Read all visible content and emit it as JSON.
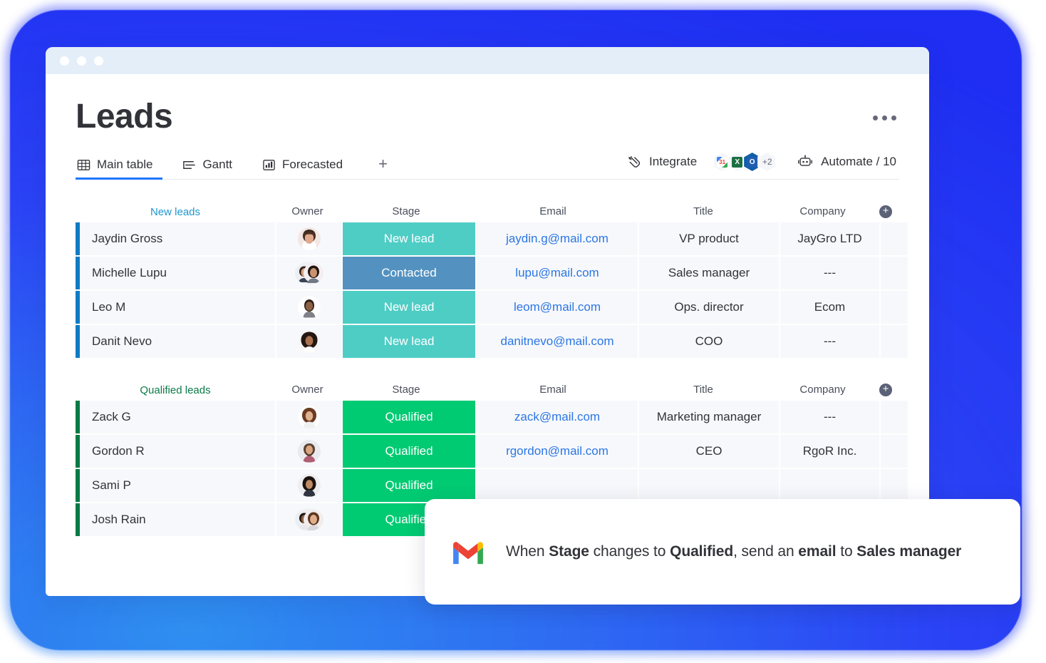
{
  "window": {
    "title_bar_dots": 3
  },
  "header": {
    "title": "Leads",
    "overflow_menu": "..."
  },
  "tabs": [
    {
      "label": "Main table",
      "icon": "table-icon",
      "active": true
    },
    {
      "label": "Gantt",
      "icon": "gantt-icon",
      "active": false
    },
    {
      "label": "Forecasted",
      "icon": "chart-bar-icon",
      "active": false
    }
  ],
  "add_tab_label": "+",
  "toolbar": {
    "integrate_label": "Integrate",
    "integration_badges": [
      {
        "name": "google-calendar",
        "label": "31"
      },
      {
        "name": "excel",
        "label": "X"
      },
      {
        "name": "outlook",
        "label": "O"
      },
      {
        "name": "more",
        "label": "+2"
      }
    ],
    "automate_label": "Automate / 10"
  },
  "columns": {
    "owner": "Owner",
    "stage": "Stage",
    "email": "Email",
    "title": "Title",
    "company": "Company",
    "add": "+"
  },
  "groups": [
    {
      "name": "New leads",
      "color": "#1f97d0",
      "rows": [
        {
          "name": "Jaydin Gross",
          "owner": "single-female",
          "stage": "New lead",
          "stage_color": "#4ecdc5",
          "email": "jaydin.g@mail.com",
          "title": "VP product",
          "company": "JayGro LTD"
        },
        {
          "name": "Michelle Lupu",
          "owner": "pair",
          "stage": "Contacted",
          "stage_color": "#5392c0",
          "email": "lupu@mail.com",
          "title": "Sales manager",
          "company": "---"
        },
        {
          "name": "Leo M",
          "owner": "single-male",
          "stage": "New lead",
          "stage_color": "#4ecdc5",
          "email": "leom@mail.com",
          "title": "Ops. director",
          "company": "Ecom"
        },
        {
          "name": "Danit Nevo",
          "owner": "single-female",
          "stage": "New lead",
          "stage_color": "#4ecdc5",
          "email": "danitnevo@mail.com",
          "title": "COO",
          "company": "---"
        }
      ]
    },
    {
      "name": "Qualified leads",
      "color": "#0b7a47",
      "rows": [
        {
          "name": "Zack G",
          "owner": "single-female",
          "stage": "Qualified",
          "stage_color": "#00ca72",
          "email": "zack@mail.com",
          "title": "Marketing manager",
          "company": "---"
        },
        {
          "name": "Gordon R",
          "owner": "single-male",
          "stage": "Qualified",
          "stage_color": "#00ca72",
          "email": "rgordon@mail.com",
          "title": "CEO",
          "company": "RgoR Inc."
        },
        {
          "name": "Sami P",
          "owner": "single-female",
          "stage": "Qualified",
          "stage_color": "#00ca72",
          "email": "",
          "title": "",
          "company": ""
        },
        {
          "name": "Josh Rain",
          "owner": "pair",
          "stage": "Qualified",
          "stage_color": "#00ca72",
          "email": "",
          "title": "",
          "company": ""
        }
      ]
    }
  ],
  "toast": {
    "icon": "gmail-icon",
    "parts": [
      {
        "text": "When ",
        "bold": false
      },
      {
        "text": "Stage",
        "bold": true
      },
      {
        "text": " changes to ",
        "bold": false
      },
      {
        "text": "Qualified",
        "bold": true
      },
      {
        "text": ", send an ",
        "bold": false
      },
      {
        "text": "email",
        "bold": true
      },
      {
        "text": " to ",
        "bold": false
      },
      {
        "text": "Sales manager",
        "bold": true
      }
    ],
    "plain_text": "When Stage changes to Qualified, send an email to Sales manager"
  },
  "colors": {
    "frame_blue": "#2b42f5",
    "frame_blue_light": "#2f8ff0",
    "accent_link": "#2b76e5",
    "tab_underline": "#1f76ff",
    "stage_new": "#4ecdc5",
    "stage_contacted": "#5392c0",
    "stage_qualified": "#00ca72",
    "group_blue_bar": "#0f7bc4",
    "group_green_bar": "#067a45",
    "cell_bg": "#f7f8fb",
    "titlebar_bg": "#e4eef8"
  }
}
